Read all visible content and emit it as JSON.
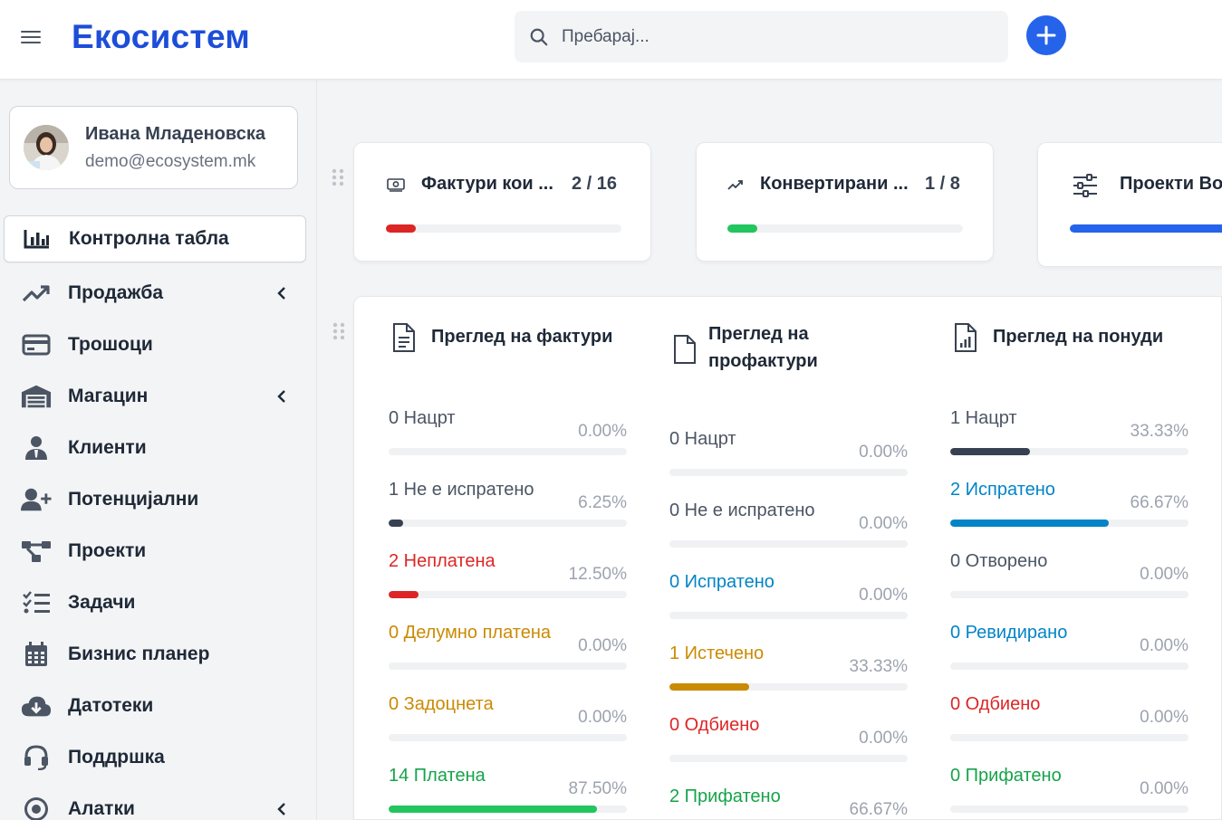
{
  "header": {
    "brand": "Екосистем",
    "search_placeholder": "Пребарај...",
    "add_icon": "plus-icon"
  },
  "user": {
    "name": "Ивана Младеновска",
    "email": "demo@ecosystem.mk"
  },
  "nav": [
    {
      "label": "Контролна табла",
      "icon": "chart-bar-icon",
      "active": true,
      "has_submenu": false
    },
    {
      "label": "Продажба",
      "icon": "trend-up-icon",
      "active": false,
      "has_submenu": true
    },
    {
      "label": "Трошоци",
      "icon": "credit-card-icon",
      "active": false,
      "has_submenu": false
    },
    {
      "label": "Магацин",
      "icon": "warehouse-icon",
      "active": false,
      "has_submenu": true
    },
    {
      "label": "Клиенти",
      "icon": "user-tie-icon",
      "active": false,
      "has_submenu": false
    },
    {
      "label": "Потенцијални",
      "icon": "user-plus-icon",
      "active": false,
      "has_submenu": false
    },
    {
      "label": "Проекти",
      "icon": "project-diagram-icon",
      "active": false,
      "has_submenu": false
    },
    {
      "label": "Задачи",
      "icon": "task-list-icon",
      "active": false,
      "has_submenu": false
    },
    {
      "label": "Бизнис планер",
      "icon": "calendar-icon",
      "active": false,
      "has_submenu": false
    },
    {
      "label": "Датотеки",
      "icon": "cloud-download-icon",
      "active": false,
      "has_submenu": false
    },
    {
      "label": "Поддршка",
      "icon": "headset-icon",
      "active": false,
      "has_submenu": false
    },
    {
      "label": "Алатки",
      "icon": "dot-circle-icon",
      "active": false,
      "has_submenu": true
    }
  ],
  "kpis": [
    {
      "title": "Фактури кои ...",
      "value": "2 / 16",
      "progress": 0.125,
      "color": "#dc2626",
      "icon": "money-bill-icon"
    },
    {
      "title": "Конвертирани ...",
      "value": "1 / 8",
      "progress": 0.125,
      "color": "#22c55e",
      "icon": "trend-up-icon"
    },
    {
      "title": "Проекти Во",
      "value": "",
      "progress": 1.0,
      "color": "#2563eb",
      "icon": "sliders-icon"
    }
  ],
  "overview": [
    {
      "title": "Преглед на фактури",
      "icon": "file-text-icon",
      "stats": [
        {
          "label": "0 Нацрт",
          "pct": "0.00%",
          "value": 0.0,
          "color": "#4b5563",
          "bar": "#374151"
        },
        {
          "label": "1 Не е испратено",
          "pct": "6.25%",
          "value": 0.0625,
          "color": "#4b5563",
          "bar": "#374151"
        },
        {
          "label": "2 Неплатена",
          "pct": "12.50%",
          "value": 0.125,
          "color": "#dc2626",
          "bar": "#dc2626"
        },
        {
          "label": "0 Делумно платена",
          "pct": "0.00%",
          "value": 0.0,
          "color": "#ca8a04",
          "bar": "#ca8a04"
        },
        {
          "label": "0 Задоцнета",
          "pct": "0.00%",
          "value": 0.0,
          "color": "#ca8a04",
          "bar": "#ca8a04"
        },
        {
          "label": "14 Платена",
          "pct": "87.50%",
          "value": 0.875,
          "color": "#16a34a",
          "bar": "#22c55e"
        }
      ]
    },
    {
      "title": "Преглед на профактури",
      "icon": "file-icon",
      "stats": [
        {
          "label": "0 Нацрт",
          "pct": "0.00%",
          "value": 0.0,
          "color": "#4b5563",
          "bar": "#374151"
        },
        {
          "label": "0 Не е испратено",
          "pct": "0.00%",
          "value": 0.0,
          "color": "#4b5563",
          "bar": "#374151"
        },
        {
          "label": "0 Испратено",
          "pct": "0.00%",
          "value": 0.0,
          "color": "#0284c7",
          "bar": "#0284c7"
        },
        {
          "label": "1 Истечено",
          "pct": "33.33%",
          "value": 0.3333,
          "color": "#ca8a04",
          "bar": "#ca8a04"
        },
        {
          "label": "0 Одбиено",
          "pct": "0.00%",
          "value": 0.0,
          "color": "#dc2626",
          "bar": "#dc2626"
        },
        {
          "label": "2 Прифатено",
          "pct": "66.67%",
          "value": 0.6667,
          "color": "#16a34a",
          "bar": "#22c55e"
        }
      ]
    },
    {
      "title": "Преглед на понуди",
      "icon": "file-chart-icon",
      "stats": [
        {
          "label": "1 Нацрт",
          "pct": "33.33%",
          "value": 0.3333,
          "color": "#4b5563",
          "bar": "#374151"
        },
        {
          "label": "2 Испратено",
          "pct": "66.67%",
          "value": 0.6667,
          "color": "#0284c7",
          "bar": "#0284c7"
        },
        {
          "label": "0 Отворено",
          "pct": "0.00%",
          "value": 0.0,
          "color": "#4b5563",
          "bar": "#374151"
        },
        {
          "label": "0 Ревидирано",
          "pct": "0.00%",
          "value": 0.0,
          "color": "#0284c7",
          "bar": "#0284c7"
        },
        {
          "label": "0 Одбиено",
          "pct": "0.00%",
          "value": 0.0,
          "color": "#dc2626",
          "bar": "#dc2626"
        },
        {
          "label": "0 Прифатено",
          "pct": "0.00%",
          "value": 0.0,
          "color": "#16a34a",
          "bar": "#22c55e"
        }
      ]
    }
  ]
}
